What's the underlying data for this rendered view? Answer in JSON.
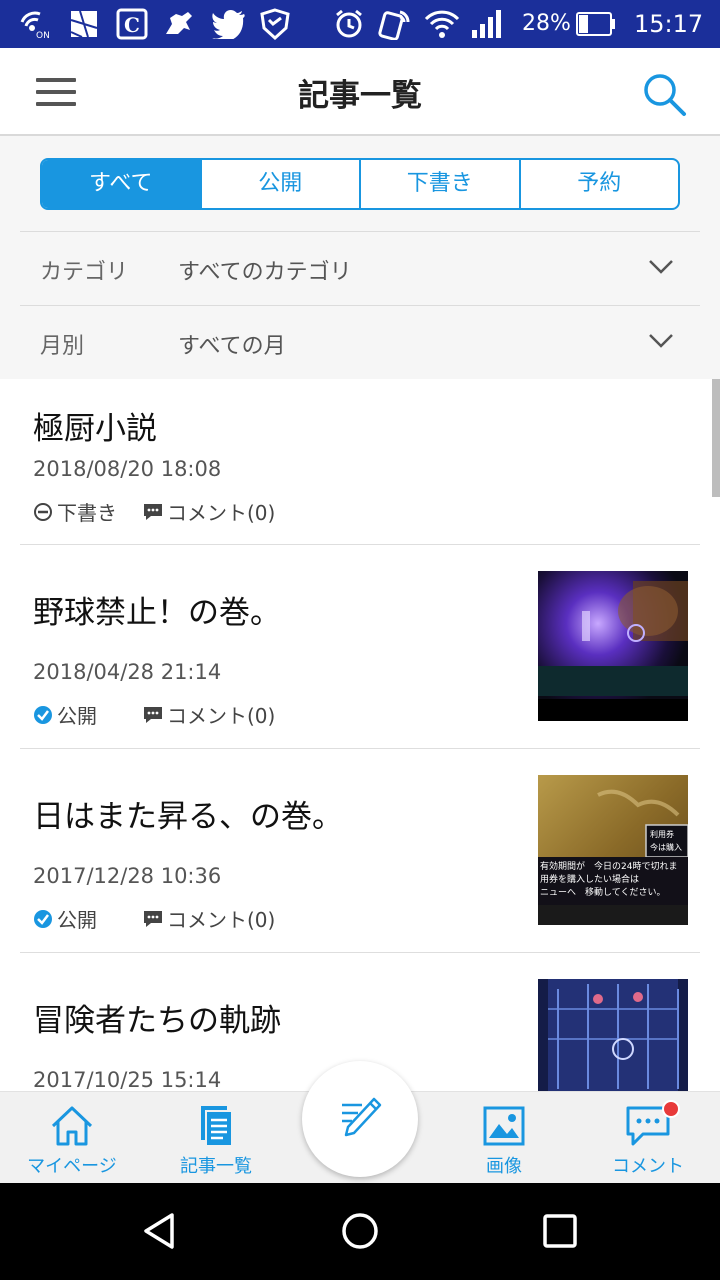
{
  "status_bar": {
    "battery_text": "28%",
    "time": "15:17",
    "left_icons": [
      "wifi-on-icon",
      "map-icon",
      "app-c-icon",
      "horse-icon",
      "twitter-icon",
      "shield-icon"
    ],
    "right_icons": [
      "alarm-icon",
      "nfc-icon",
      "wifi-icon",
      "signal-icon",
      "battery-icon"
    ]
  },
  "header": {
    "title": "記事一覧"
  },
  "filter": {
    "tabs": [
      {
        "label": "すべて",
        "active": true
      },
      {
        "label": "公開",
        "active": false
      },
      {
        "label": "下書き",
        "active": false
      },
      {
        "label": "予約",
        "active": false
      }
    ],
    "category": {
      "label": "カテゴリ",
      "value": "すべてのカテゴリ"
    },
    "month": {
      "label": "月別",
      "value": "すべての月"
    }
  },
  "articles": [
    {
      "title": "極厨小説",
      "date": "2018/08/20 18:08",
      "status": "下書き",
      "status_type": "draft",
      "comments": "コメント(0)",
      "has_thumb": false
    },
    {
      "title": "野球禁止！の巻。",
      "date": "2018/04/28 21:14",
      "status": "公開",
      "status_type": "public",
      "comments": "コメント(0)",
      "has_thumb": true
    },
    {
      "title": "日はまた昇る、の巻。",
      "date": "2017/12/28 10:36",
      "status": "公開",
      "status_type": "public",
      "comments": "コメント(0)",
      "has_thumb": true
    },
    {
      "title": "冒険者たちの軌跡",
      "date": "2017/10/25 15:14",
      "status": "",
      "status_type": "",
      "comments": "",
      "has_thumb": true
    }
  ],
  "thumb_text": {
    "line1": "利用券",
    "line2": "今は購入",
    "line3": "有効期間が　今日の24時で切れま",
    "line4": "用券を購入したい場合は",
    "line5": "ニューへ　移動してください。"
  },
  "bottom_nav": {
    "items": [
      {
        "label": "マイページ",
        "icon": "home-icon"
      },
      {
        "label": "記事一覧",
        "icon": "document-icon"
      },
      {
        "label": "画像",
        "icon": "image-icon"
      },
      {
        "label": "コメント",
        "icon": "comment-icon"
      }
    ],
    "fab_icon": "pencil-icon"
  },
  "colors": {
    "accent": "#1996e0",
    "status_bar": "#1b2f9a",
    "badge": "#e83a3a"
  }
}
